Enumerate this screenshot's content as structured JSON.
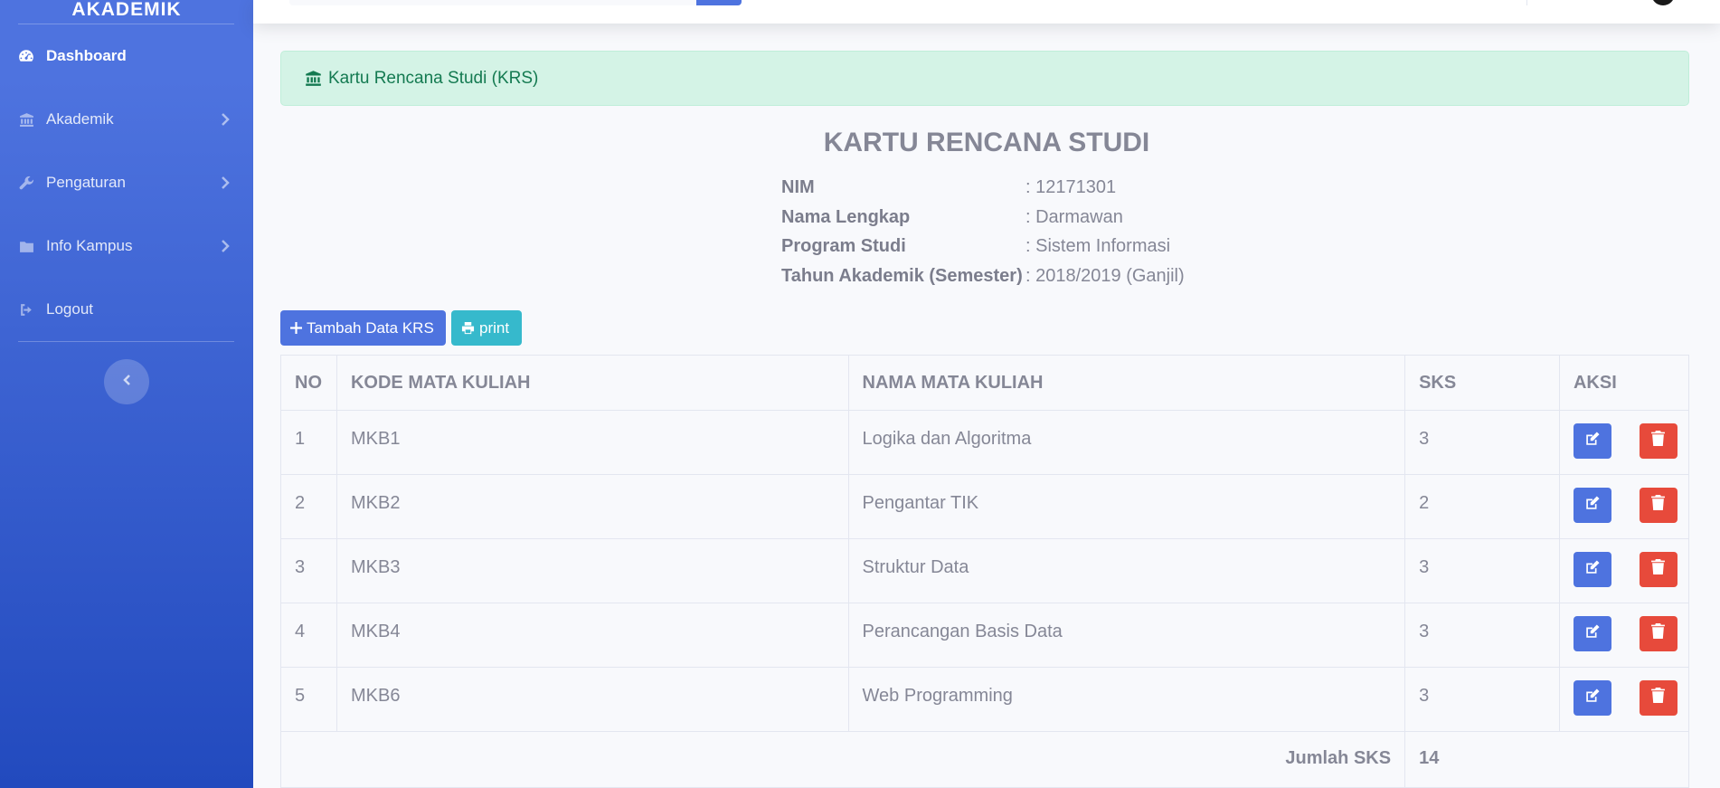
{
  "sidebar": {
    "brand": "AKADEMIK",
    "items": [
      {
        "label": "Dashboard",
        "icon": "tachometer-icon",
        "active": true
      },
      {
        "label": "Akademik",
        "icon": "university-icon"
      },
      {
        "label": "Pengaturan",
        "icon": "wrench-icon"
      },
      {
        "label": "Info Kampus",
        "icon": "folder-icon"
      },
      {
        "label": "Logout",
        "icon": "sign-out-icon"
      }
    ],
    "toggle_icon": "chevron-left-icon"
  },
  "alert": {
    "text": "Kartu Rencana Studi (KRS)",
    "icon": "university-icon"
  },
  "title": "KARTU RENCANA STUDI",
  "info": [
    {
      "label": "NIM",
      "value": ": 12171301"
    },
    {
      "label": "Nama Lengkap",
      "value": ": Darmawan"
    },
    {
      "label": "Program Studi",
      "value": ": Sistem Informasi"
    },
    {
      "label": "Tahun Akademik (Semester)",
      "value": ": 2018/2019 (Ganjil)"
    }
  ],
  "buttons": {
    "add": "Tambah Data KRS",
    "print": "print"
  },
  "table": {
    "headers": [
      "NO",
      "KODE MATA KULIAH",
      "NAMA MATA KULIAH",
      "SKS",
      "AKSI"
    ],
    "rows": [
      {
        "no": "1",
        "kode": "MKB1",
        "nama": "Logika dan Algoritma",
        "sks": "3"
      },
      {
        "no": "2",
        "kode": "MKB2",
        "nama": "Pengantar TIK",
        "sks": "2"
      },
      {
        "no": "3",
        "kode": "MKB3",
        "nama": "Struktur Data",
        "sks": "3"
      },
      {
        "no": "4",
        "kode": "MKB4",
        "nama": "Perancangan Basis Data",
        "sks": "3"
      },
      {
        "no": "5",
        "kode": "MKB6",
        "nama": "Web Programming",
        "sks": "3"
      }
    ],
    "total_label": "Jumlah SKS",
    "total_value": "14"
  },
  "colors": {
    "primary": "#4e73df",
    "info": "#36b9cc",
    "danger": "#e74a3b",
    "success_bg": "#d4f3e6"
  }
}
